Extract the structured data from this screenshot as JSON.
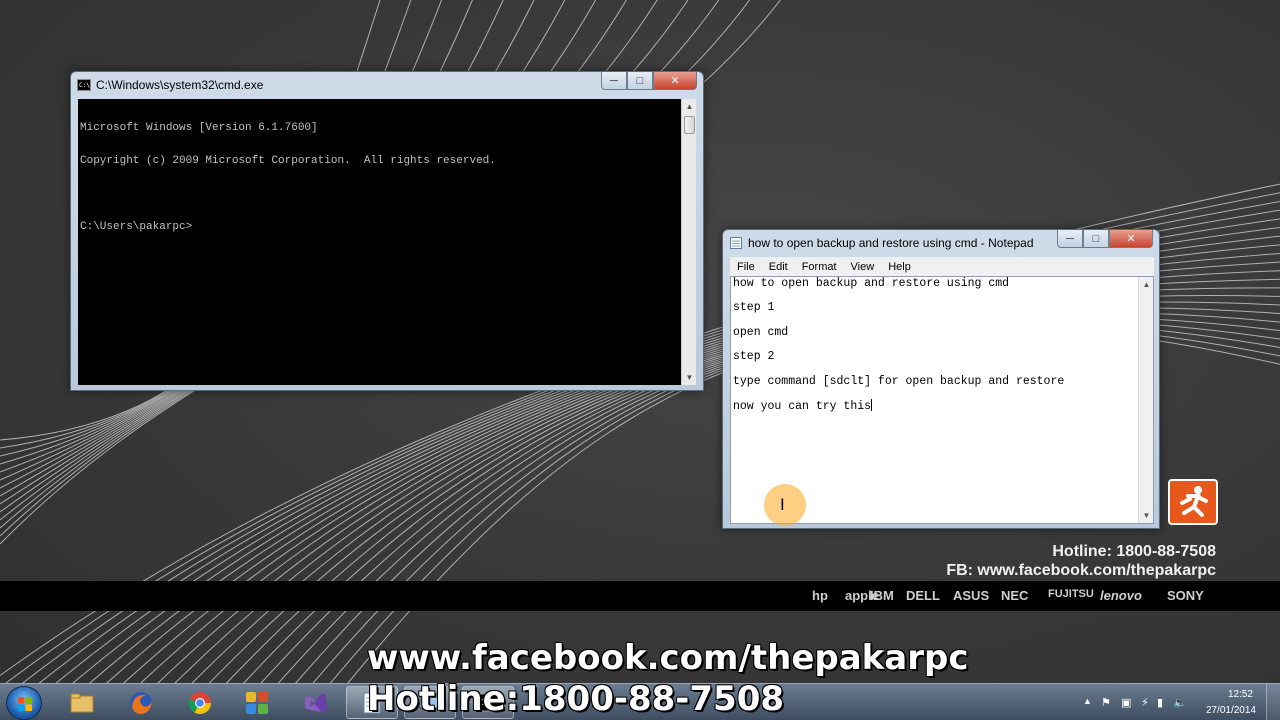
{
  "cmd": {
    "title": "C:\\Windows\\system32\\cmd.exe",
    "lines": [
      "Microsoft Windows [Version 6.1.7600]",
      "Copyright (c) 2009 Microsoft Corporation.  All rights reserved.",
      "",
      "C:\\Users\\pakarpc>"
    ]
  },
  "notepad": {
    "title": "how to open backup and restore using cmd - Notepad",
    "menu": [
      "File",
      "Edit",
      "Format",
      "View",
      "Help"
    ],
    "lines": [
      "how to open backup and restore using cmd",
      "step 1",
      "open cmd",
      "step 2",
      "type command [sdclt] for open backup and restore",
      "now you can try this"
    ]
  },
  "window_controls": {
    "minimize": "─",
    "maximize": "□",
    "close": "✕"
  },
  "branding": {
    "hotline": "Hotline: 1800-88-7508",
    "fb": "FB: www.facebook.com/thepakarpc",
    "logos": [
      "hp",
      "apple",
      "IBM",
      "DELL",
      "ASUS",
      "NEC",
      "FUJITSU",
      "lenovo",
      "SONY"
    ]
  },
  "overlay": {
    "facebook": "www.facebook.com/thepakarpc",
    "hotline": "Hotline:1800-88-7508"
  },
  "taskbar": {
    "items": [
      {
        "name": "windows-explorer",
        "active": false
      },
      {
        "name": "firefox",
        "active": false
      },
      {
        "name": "chrome",
        "active": false
      },
      {
        "name": "app-grid",
        "active": false
      },
      {
        "name": "visual-studio",
        "active": false
      },
      {
        "name": "notepad",
        "active": true
      },
      {
        "name": "remote-desktop",
        "active": true
      },
      {
        "name": "cmd",
        "active": true
      }
    ],
    "clock": {
      "time": "12:52",
      "date": "27/01/2014"
    }
  },
  "colors": {
    "cmd_text": "#c0c0c0",
    "accent_orange": "#e8581c",
    "cursor_highlight": "#ffaa1e"
  }
}
